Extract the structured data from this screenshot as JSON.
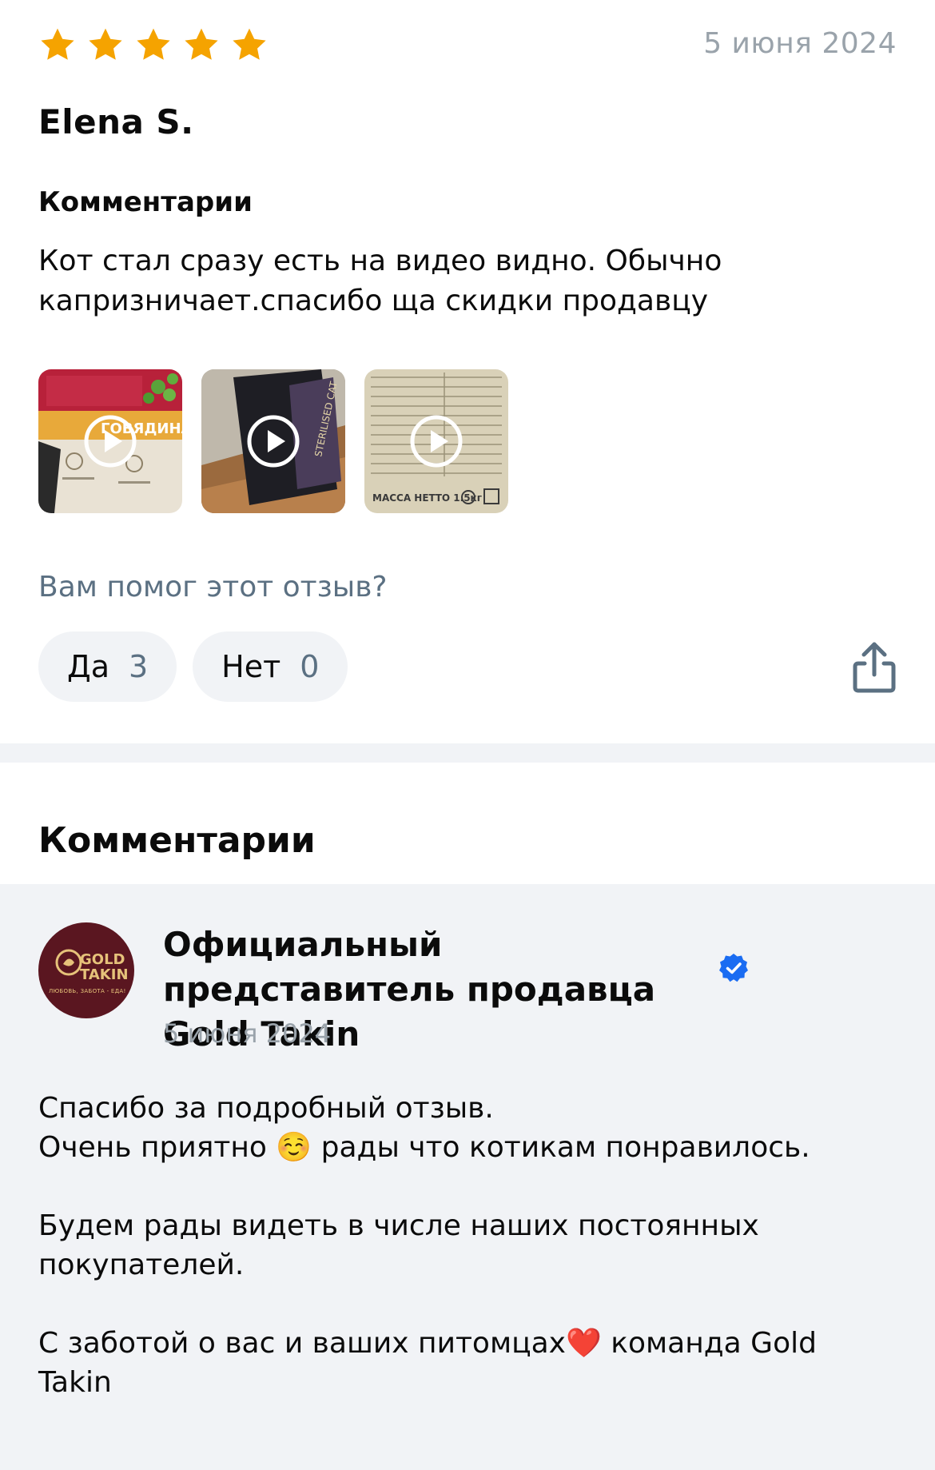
{
  "review": {
    "rating": 5,
    "max_rating": 5,
    "date": "5 июня 2024",
    "author": "Elena S.",
    "section_title": "Комментарии",
    "text_line1": "Кот стал сразу есть на видео видно. Обычно",
    "text_line2": "капризничает.спасибо ща скидки продавцу",
    "media": [
      {
        "kind": "video",
        "caption": "ГОВЯДИНА"
      },
      {
        "kind": "video",
        "caption": "STERILISED CAT"
      },
      {
        "kind": "video",
        "caption": "МАССА НЕТТО 1.5кг"
      }
    ],
    "helpful_question": "Вам помог этот отзыв?",
    "yes_label": "Да",
    "yes_count": "3",
    "no_label": "Нет",
    "no_count": "0"
  },
  "comments_heading": "Комментарии",
  "reply": {
    "logo_line1": "GOLD",
    "logo_line2": "TAKIN",
    "logo_tagline": "ЛЮБОВЬ, ЗАБОТА - ЕДА!",
    "seller_name": "Официальный представитель продавца Gold Takin",
    "date": "5 июня 2024",
    "line1": "Спасибо за подробный отзыв.",
    "line2": "Очень приятно ☺️ рады что котикам понравилось.",
    "line3": "Будем рады видеть в числе наших постоянных покупателей.",
    "line4": "С заботой о вас и ваших питомцах❤️ команда Gold Takin"
  },
  "colors": {
    "star": "#f5a300",
    "muted": "#9aa3ab",
    "accent_text": "#5b7082",
    "verified": "#1a6cf2",
    "logo_bg": "#5a1620"
  },
  "icons": {
    "rating": "star-icon",
    "play": "play-icon",
    "share": "share-icon",
    "verified": "verified-check-icon"
  }
}
